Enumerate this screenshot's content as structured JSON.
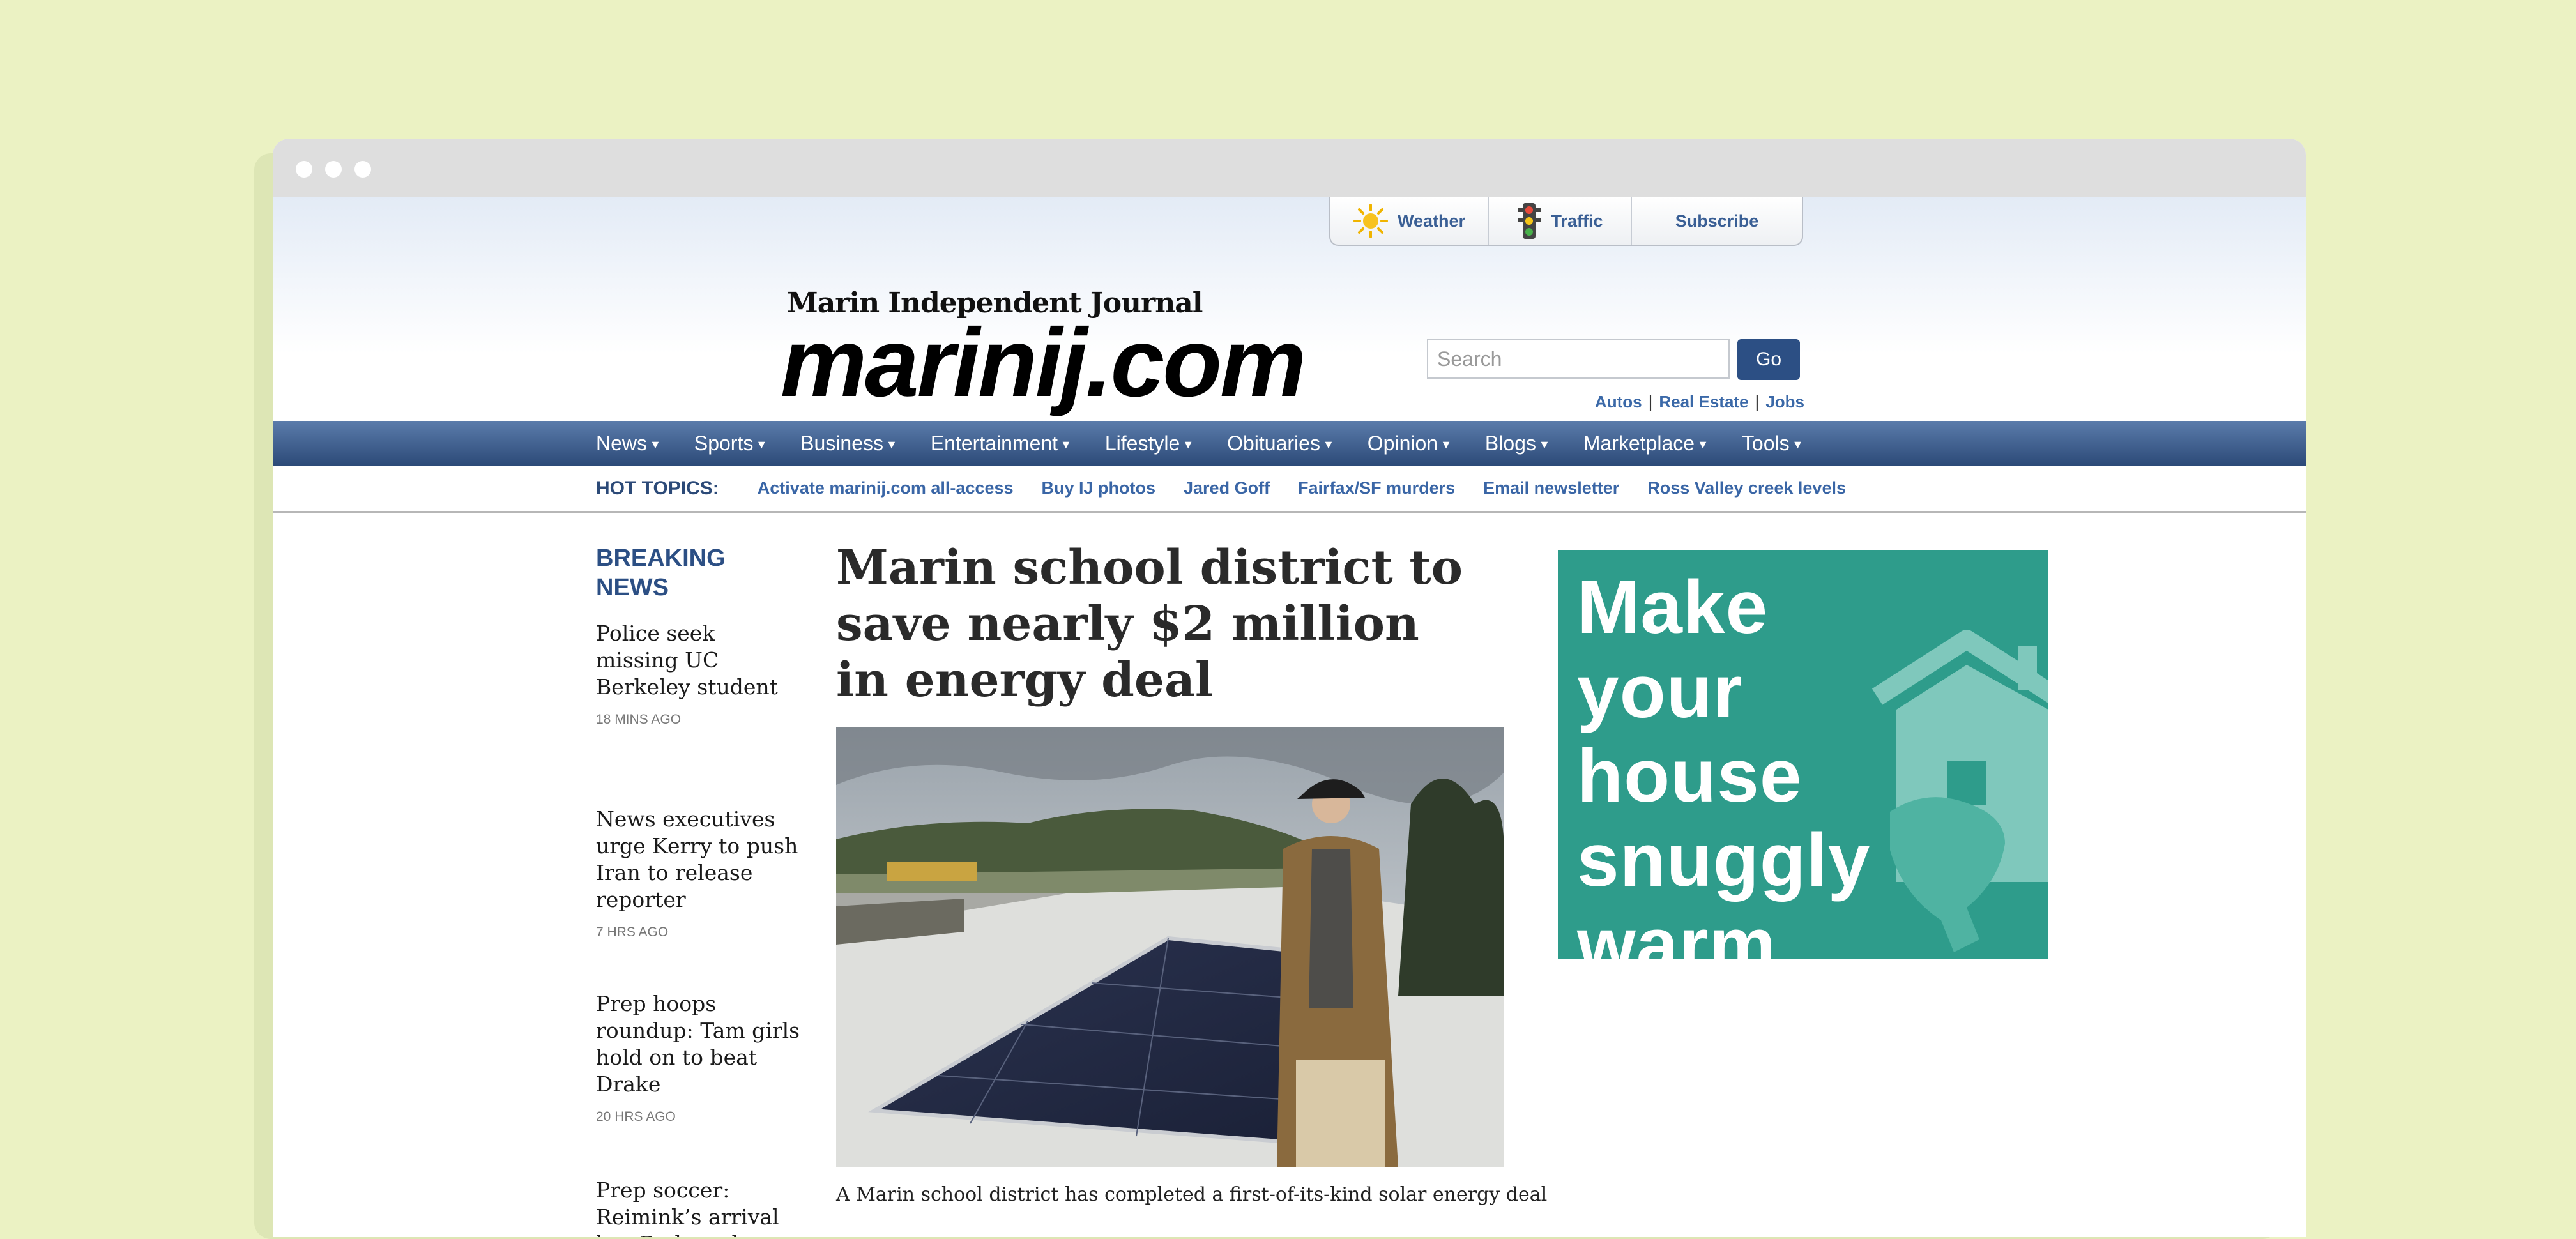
{
  "util_bar": {
    "weather": "Weather",
    "traffic": "Traffic",
    "subscribe": "Subscribe"
  },
  "brand": {
    "small": "Marin Independent Journal",
    "big": "marinij.com"
  },
  "search": {
    "placeholder": "Search",
    "button": "Go"
  },
  "classifieds": [
    "Autos",
    "Real Estate",
    "Jobs"
  ],
  "nav": [
    "News",
    "Sports",
    "Business",
    "Entertainment",
    "Lifestyle",
    "Obituaries",
    "Opinion",
    "Blogs",
    "Marketplace",
    "Tools"
  ],
  "hot_topics": {
    "label": "HOT TOPICS:",
    "links": [
      "Activate marinij.com all-access",
      "Buy IJ photos",
      "Jared Goff",
      "Fairfax/SF murders",
      "Email newsletter",
      "Ross Valley creek levels"
    ]
  },
  "breaking": {
    "heading": "BREAKING NEWS",
    "items": [
      {
        "title": "Police seek missing UC Berkeley student",
        "time": "18 MINS AGO"
      },
      {
        "title": "News executives urge Kerry to push Iran to release reporter",
        "time": "7 HRS AGO"
      },
      {
        "title": "Prep hoops roundup: Tam girls hold on to beat Drake",
        "time": "20 HRS AGO"
      },
      {
        "title": "Prep soccer: Reimink’s arrival has Redwood",
        "time": ""
      }
    ]
  },
  "main_story": {
    "headline": "Marin school district to save nearly $2 million in energy deal",
    "summary": "A Marin school district has completed a first-of-its-kind solar energy deal"
  },
  "ad": {
    "text": "Make your house snuggly warm.",
    "background": "#2e9c8b"
  }
}
